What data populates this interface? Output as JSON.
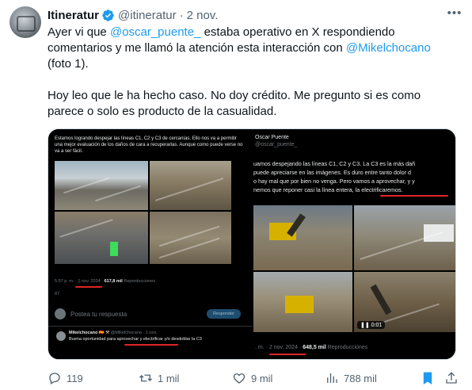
{
  "tweet": {
    "author_name": "Itineratur",
    "author_handle": "@itineratur",
    "separator": "·",
    "date": "2 nov.",
    "text_line1_a": "Ayer vi que ",
    "mention1": "@oscar_puente_",
    "text_line1_b": " estaba operativo en X respondiendo",
    "text_line2_a": "comentarios y me llamó la atención esta interacción con ",
    "mention2": "@Mikelchocano",
    "text_line3": "(foto 1).",
    "text_para2_line1": "Hoy leo que le ha hecho caso. No doy crédito. Me pregunto si es como",
    "text_para2_line2": "parece o solo es producto de la casualidad."
  },
  "media_left": {
    "tweet_text": "Estamos logrando despejar las líneas C1, C2 y C3 de cercanías. Ello nos va a permitir una mejor evaluación de los daños de cara a recuperarlas. Aunque como puede verse no va a ser fácil.",
    "meta_time": "5:57 p. m. · ",
    "meta_date": "1 nov. 2024",
    "meta_views": "617,8 mil",
    "meta_views_label": " Reproducciones",
    "stats": [
      "87",
      "",
      "",
      "",
      ""
    ],
    "reply_placeholder": "Postea tu respuesta",
    "reply_button": "Responder",
    "quote_name": "Mikelchocano",
    "quote_flags": "🇪🇸 ⚒",
    "quote_handle": "@Mikelchocano · 1 nov.",
    "quote_text_a": "Buena oportunidad para ",
    "quote_text_b": "aprovechar y electrificar",
    "quote_text_c": " y/o desdoblar la C3"
  },
  "media_right": {
    "author_name": "Oscar Puente",
    "author_handle": "@oscar_puente_",
    "text_line1": "uamos despejando las líneas C1, C2 y C3. La C3 es la más dañ",
    "text_line2": "puede apreciarse en las imágenes. Es duro entre tanto dolor d",
    "text_line3": "o hay mal que por bien no venga. Pero vamos a aprovechar, y y",
    "text_line4_a": "nemos que reponer casi la línea entera, ",
    "text_line4_b": "la electrificaremos",
    "text_line4_c": ".",
    "video_time": "0:01",
    "meta_time": ". m. · ",
    "meta_date": "2 nov. 2024",
    "meta_views": "648,5 mil",
    "meta_views_label": " Reproducciones"
  },
  "actions": {
    "reply_count": "119",
    "retweet_count": "1 mil",
    "like_count": "9 mil",
    "views_count": "788 mil"
  },
  "colors": {
    "accent": "#1d9bf0",
    "text": "#0f1419",
    "secondary": "#536471",
    "underline": "#e02424"
  },
  "icons": [
    "verified-icon",
    "more-icon",
    "reply-icon",
    "retweet-icon",
    "like-icon",
    "views-icon",
    "bookmark-icon",
    "share-icon"
  ]
}
